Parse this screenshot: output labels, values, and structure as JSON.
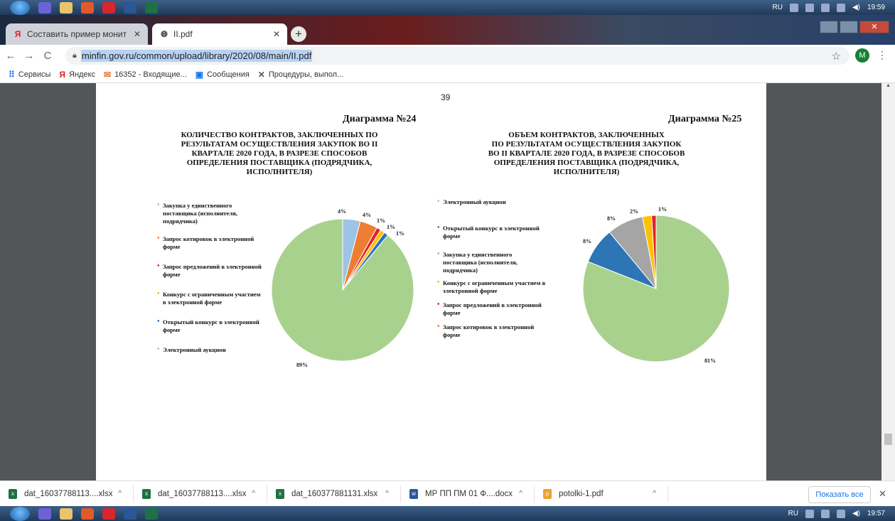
{
  "taskbar_top": {
    "lang": "RU",
    "time": "19:59"
  },
  "taskbar_bottom": {
    "lang": "RU",
    "time": "19:57"
  },
  "tabs": [
    {
      "title": "Составить пример мониторинг",
      "favicon": "Я"
    },
    {
      "title": "II.pdf",
      "favicon": "globe-icon"
    }
  ],
  "address": {
    "url": "minfin.gov.ru/common/upload/library/2020/08/main/II.pdf",
    "avatar": "M"
  },
  "bookmarks": [
    {
      "label": "Сервисы",
      "icon": "apps-grid-icon"
    },
    {
      "label": "Яндекс",
      "icon": "yandex-icon"
    },
    {
      "label": "16352 - Входящие...",
      "icon": "mail-icon"
    },
    {
      "label": "Сообщения",
      "icon": "messages-icon"
    },
    {
      "label": "Процедуры, выпол...",
      "icon": "tools-icon"
    }
  ],
  "pdf": {
    "page_number": "39",
    "chart_data": [
      {
        "type": "pie",
        "heading": "Диаграмма №24",
        "title": "КОЛИЧЕСТВО КОНТРАКТОВ, ЗАКЛЮЧЕННЫХ ПО РЕЗУЛЬТАТАМ ОСУЩЕСТВЛЕНИЯ ЗАКУПОК ВО II КВАРТАЛЕ 2020 ГОДА, В РАЗРЕЗЕ СПОСОБОВ ОПРЕДЕЛЕНИЯ ПОСТАВЩИКА (ПОДРЯДЧИКА, ИСПОЛНИТЕЛЯ)",
        "title_lines": [
          "КОЛИЧЕСТВО КОНТРАКТОВ, ЗАКЛЮЧЕННЫХ ПО",
          "РЕЗУЛЬТАТАМ ОСУЩЕСТВЛЕНИЯ ЗАКУПОК ВО II",
          "КВАРТАЛЕ 2020 ГОДА, В РАЗРЕЗЕ СПОСОБОВ",
          "ОПРЕДЕЛЕНИЯ ПОСТАВЩИКА (ПОДРЯДЧИКА,",
          "ИСПОЛНИТЕЛЯ)"
        ],
        "slices": [
          {
            "label": "Закупка у единственного поставщика (исполнителя, подрядчика)",
            "value": 4,
            "display": "4%",
            "color": "#9dc3e6"
          },
          {
            "label": "Запрос котировок в электронной форме",
            "value": 4,
            "display": "4%",
            "color": "#ed7d31"
          },
          {
            "label": "Запрос предложений в электронной форме",
            "value": 1,
            "display": "1%",
            "color": "#e8202a"
          },
          {
            "label": "Конкурс с ограниченным участием в электронной форме",
            "value": 1,
            "display": "1%",
            "color": "#ffc000"
          },
          {
            "label": "Открытый конкурс в электронной форме",
            "value": 1,
            "display": "1%",
            "color": "#2e75b6"
          },
          {
            "label": "Электронный аукцион",
            "value": 89,
            "display": "89%",
            "color": "#a9d18e"
          }
        ]
      },
      {
        "type": "pie",
        "heading": "Диаграмма №25",
        "title": "ОБЪЕМ КОНТРАКТОВ, ЗАКЛЮЧЕННЫХ ПО РЕЗУЛЬТАТАМ ОСУЩЕСТВЛЕНИЯ ЗАКУПОК ВО II КВАРТАЛЕ 2020 ГОДА, В РАЗРЕЗЕ СПОСОБОВ ОПРЕДЕЛЕНИЯ ПОСТАВЩИКА (ПОДРЯДЧИКА, ИСПОЛНИТЕЛЯ)",
        "title_lines": [
          "ОБЪЕМ КОНТРАКТОВ, ЗАКЛЮЧЕННЫХ",
          "ПО РЕЗУЛЬТАТАМ ОСУЩЕСТВЛЕНИЯ ЗАКУПОК",
          "ВО II КВАРТАЛЕ 2020 ГОДА, В РАЗРЕЗЕ СПОСОБОВ",
          "ОПРЕДЕЛЕНИЯ ПОСТАВЩИКА (ПОДРЯДЧИКА,",
          "ИСПОЛНИТЕЛЯ)"
        ],
        "slices": [
          {
            "label": "Электронный аукцион",
            "value": 81,
            "display": "81%",
            "color": "#a9d18e"
          },
          {
            "label": "Открытый конкурс в электронной форме",
            "value": 8,
            "display": "8%",
            "color": "#2e75b6"
          },
          {
            "label": "Закупка у единственного поставщика (исполнителя, подрядчика)",
            "value": 8,
            "display": "8%",
            "color": "#a5a5a5"
          },
          {
            "label": "Конкурс с ограниченным участием в электронной форме",
            "value": 2,
            "display": "2%",
            "color": "#ffc000"
          },
          {
            "label": "Запрос предложений в электронной форме",
            "value": 1,
            "display": "1%",
            "color": "#e8202a"
          },
          {
            "label": "Запрос котировок в электронной форме",
            "value": 0,
            "display": "",
            "color": "#ed7d31"
          }
        ]
      }
    ]
  },
  "downloads": [
    {
      "name": "dat_16037788113....xlsx",
      "type": "xlsx"
    },
    {
      "name": "dat_16037788113....xlsx",
      "type": "xlsx"
    },
    {
      "name": "dat_160377881131.xlsx",
      "type": "xlsx"
    },
    {
      "name": "МР ПП ПМ 01 Ф....docx",
      "type": "docx"
    },
    {
      "name": "potolki-1.pdf",
      "type": "pdf"
    }
  ],
  "show_all_label": "Показать все"
}
